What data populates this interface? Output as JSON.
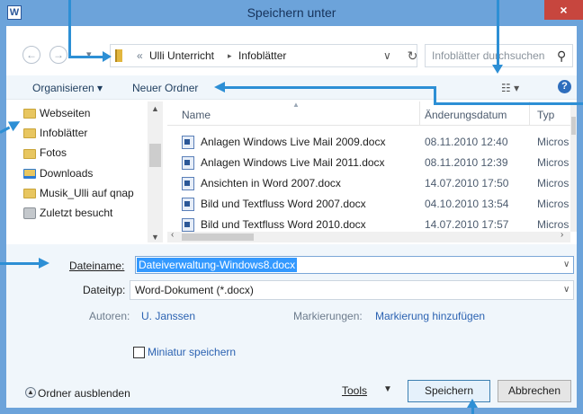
{
  "window": {
    "title": "Speichern unter",
    "app_icon": "W",
    "close_glyph": "×"
  },
  "address": {
    "overflow": "«",
    "crumbs": [
      "Ulli Unterricht",
      "Infoblätter"
    ],
    "separator": "▸",
    "dropdown_glyph": "∨",
    "refresh_glyph": "↻",
    "search_placeholder": "Infoblätter durchsuchen",
    "search_glyph": "⚲"
  },
  "toolbar": {
    "organize": "Organisieren ▾",
    "new_folder": "Neuer Ordner",
    "view_glyph": "☷ ▾",
    "help_glyph": "?"
  },
  "nav_pane": [
    {
      "label": "Webseiten",
      "icon": "folder-icon"
    },
    {
      "label": "Infoblätter",
      "icon": "folder-icon"
    },
    {
      "label": "Fotos",
      "icon": "folder-icon"
    },
    {
      "label": "Downloads",
      "icon": "downloads-icon"
    },
    {
      "label": "Musik_Ulli auf qnap",
      "icon": "folder-icon"
    },
    {
      "label": "Zuletzt besucht",
      "icon": "recent-places-icon"
    }
  ],
  "columns": {
    "name": "Name",
    "date": "Änderungsdatum",
    "type": "Typ"
  },
  "files": [
    {
      "name": "Anlagen Windows Live Mail 2009.docx",
      "date": "08.11.2010 12:40",
      "type": "Micros"
    },
    {
      "name": "Anlagen Windows Live Mail 2011.docx",
      "date": "08.11.2010 12:39",
      "type": "Micros"
    },
    {
      "name": "Ansichten in Word 2007.docx",
      "date": "14.07.2010 17:50",
      "type": "Micros"
    },
    {
      "name": "Bild und Textfluss  Word 2007.docx",
      "date": "04.10.2010 13:54",
      "type": "Micros"
    },
    {
      "name": "Bild und Textfluss  Word 2010.docx",
      "date": "14.07.2010 17:57",
      "type": "Micros"
    }
  ],
  "form": {
    "filename_label": "Dateiname:",
    "filename_value": "Dateiverwaltung-Windows8.docx",
    "filetype_label": "Dateityp:",
    "filetype_value": "Word-Dokument (*.docx)",
    "authors_label": "Autoren:",
    "authors_value": "U. Janssen",
    "tags_label": "Markierungen:",
    "tags_value": "Markierung hinzufügen",
    "thumbnail_label": "Miniatur speichern",
    "thumbnail_checked": false
  },
  "footer": {
    "hide_folders": "Ordner ausblenden",
    "tools": "Tools",
    "save": "Speichern",
    "cancel": "Abbrechen"
  },
  "colors": {
    "titlebar": "#6ca3da",
    "close": "#c7463e",
    "callout_arrow": "#2d8fd5",
    "selection": "#3399ff"
  }
}
